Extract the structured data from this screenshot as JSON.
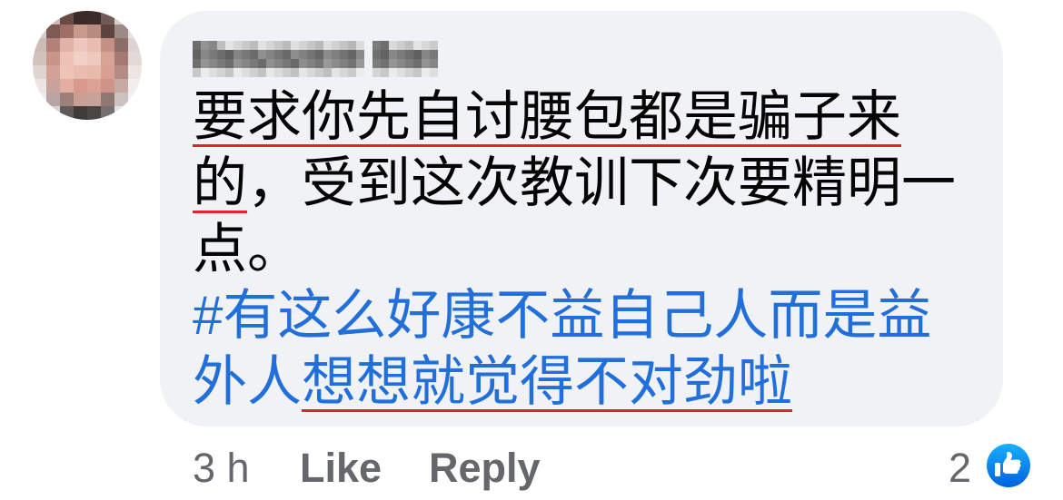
{
  "comment": {
    "lines": [
      [
        {
          "text": "要求你先自讨腰包都是骗子来",
          "highlighted": true
        }
      ],
      [
        {
          "text": "的",
          "highlighted": true
        },
        {
          "text": "，受到这次教训下次要精明一",
          "highlighted": false
        }
      ],
      [
        {
          "text": "点。",
          "highlighted": false
        }
      ]
    ],
    "hashtag_lines": [
      [
        {
          "text": "#有这么好康不益自己人而是益",
          "highlighted": false
        }
      ],
      [
        {
          "text": "外人",
          "highlighted": false
        },
        {
          "text": "想想就觉得不对劲啦",
          "highlighted": true
        }
      ]
    ]
  },
  "footer": {
    "timestamp": "3 h",
    "like_label": "Like",
    "reply_label": "Reply",
    "reaction_count": "2",
    "reaction_icon": "thumbs-up-icon"
  },
  "colors": {
    "bubble": "#F0F2F5",
    "text": "#050505",
    "hashtag": "#216FDB",
    "highlight_underline": "#E0242F",
    "meta_text": "#65676B",
    "like_icon": "#1877F2"
  }
}
